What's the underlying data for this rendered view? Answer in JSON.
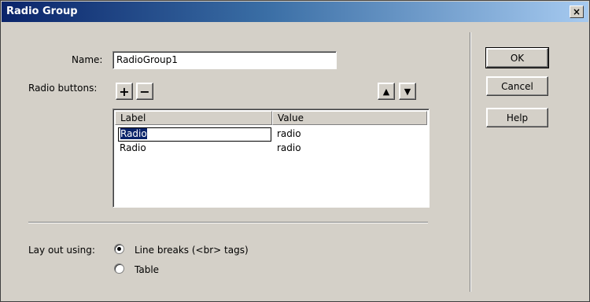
{
  "window": {
    "title": "Radio Group",
    "close_label": "×"
  },
  "form": {
    "name_label": "Name:",
    "name_value": "RadioGroup1",
    "radio_buttons_label": "Radio buttons:",
    "add_label": "+",
    "remove_label": "−",
    "up_label": "▲",
    "down_label": "▼"
  },
  "table": {
    "headers": [
      "Label",
      "Value"
    ],
    "rows": [
      {
        "label": "Radio",
        "value": "radio"
      },
      {
        "label": "Radio",
        "value": "radio"
      }
    ]
  },
  "layout_options": {
    "label": "Lay out using:",
    "options": [
      "Line breaks (<br> tags)",
      "Table"
    ],
    "selected": "Line breaks (<br> tags)"
  },
  "buttons": {
    "ok": "OK",
    "cancel": "Cancel",
    "help": "Help"
  }
}
